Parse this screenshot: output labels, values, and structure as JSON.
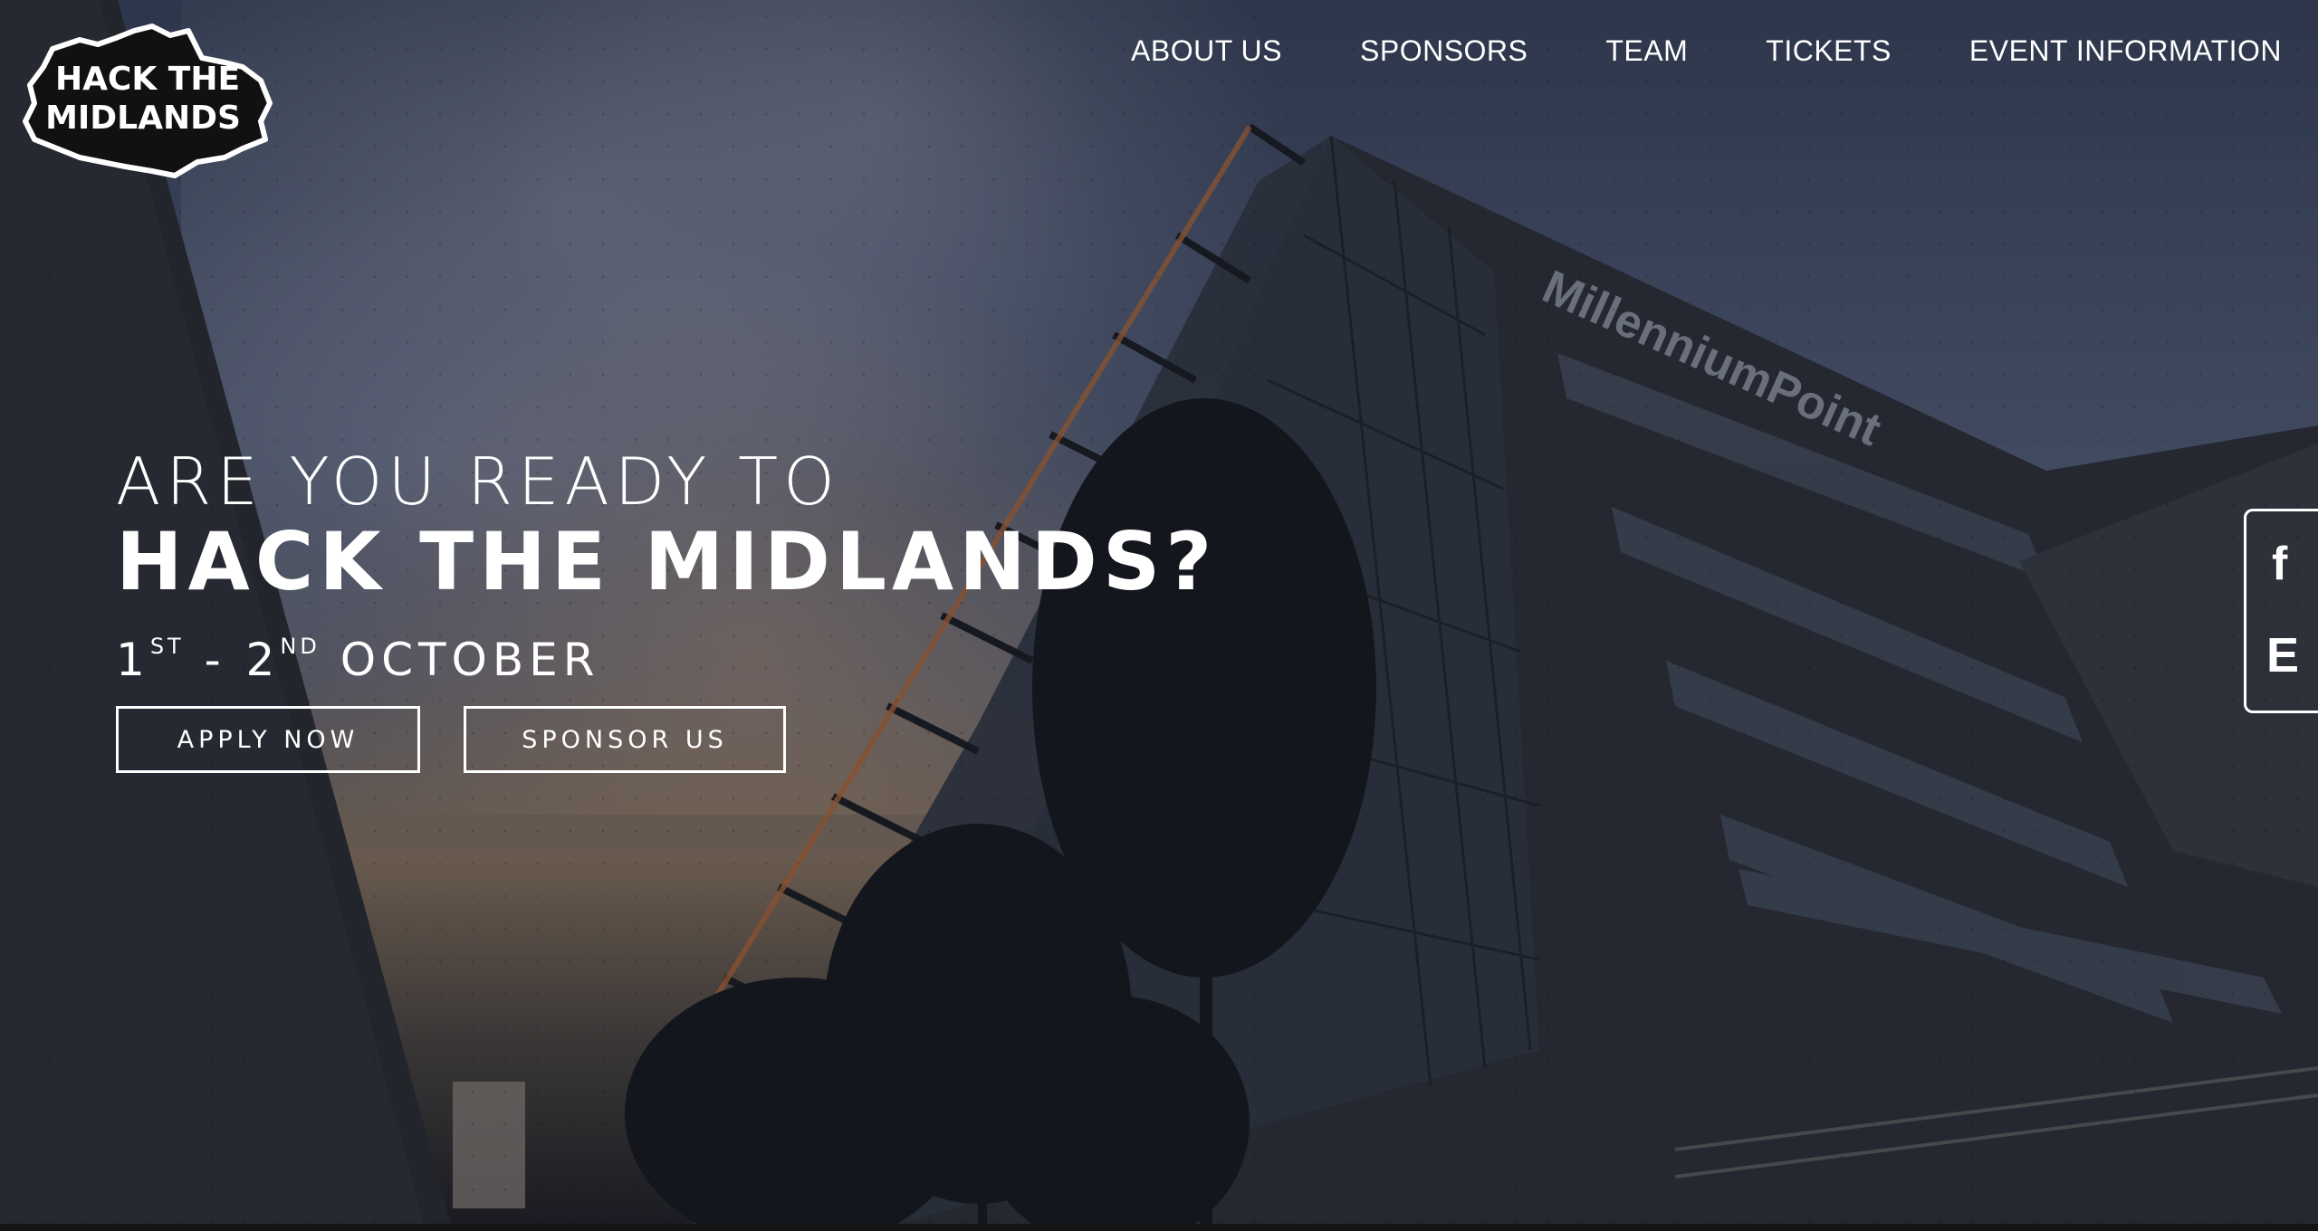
{
  "brand": {
    "logo_text_line1": "HACK THE",
    "logo_text_line2": "MIDLANDS"
  },
  "nav": {
    "items": [
      {
        "label": "ABOUT US"
      },
      {
        "label": "SPONSORS"
      },
      {
        "label": "TEAM"
      },
      {
        "label": "TICKETS"
      },
      {
        "label": "EVENT INFORMATION"
      }
    ]
  },
  "hero": {
    "line1": "ARE YOU READY TO",
    "line2": "HACK THE MIDLANDS?",
    "date_day1": "1",
    "date_day1_suffix": "ST",
    "date_separator": "- 2",
    "date_day2_suffix": "ND",
    "date_month": "OCTOBER",
    "building_sign": "MillenniumPoint"
  },
  "buttons": {
    "apply_label": "APPLY NOW",
    "sponsor_label": "SPONSOR US"
  },
  "social": {
    "facebook_glyph": "f",
    "eventbrite_glyph": "E"
  },
  "colors": {
    "text": "#ffffff",
    "overlay": "#1b2030"
  },
  "icons": [
    "logo-map-icon",
    "facebook-icon",
    "eventbrite-icon"
  ]
}
